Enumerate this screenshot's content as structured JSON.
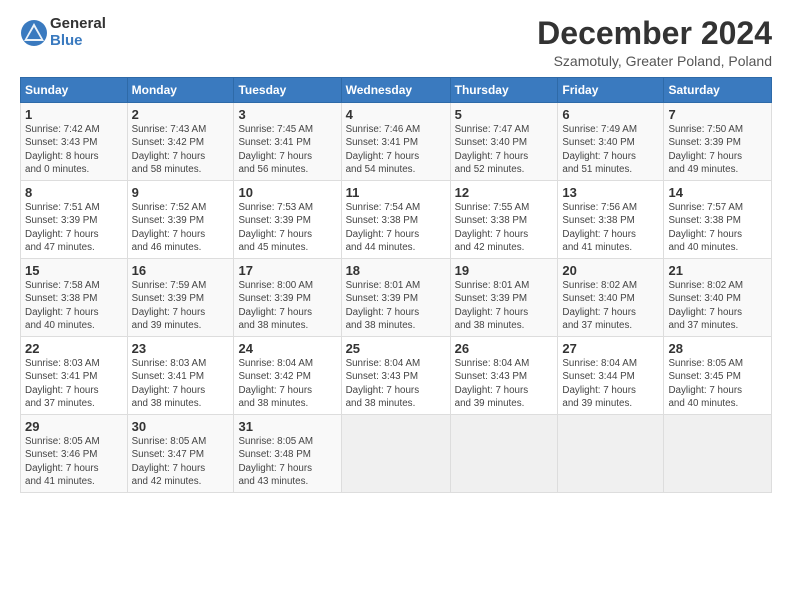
{
  "logo": {
    "general": "General",
    "blue": "Blue"
  },
  "title": "December 2024",
  "subtitle": "Szamotuly, Greater Poland, Poland",
  "days_header": [
    "Sunday",
    "Monday",
    "Tuesday",
    "Wednesday",
    "Thursday",
    "Friday",
    "Saturday"
  ],
  "weeks": [
    [
      {
        "day": "1",
        "sunrise": "7:42 AM",
        "sunset": "3:43 PM",
        "daylight": "8 hours and 0 minutes."
      },
      {
        "day": "2",
        "sunrise": "7:43 AM",
        "sunset": "3:42 PM",
        "daylight": "7 hours and 58 minutes."
      },
      {
        "day": "3",
        "sunrise": "7:45 AM",
        "sunset": "3:41 PM",
        "daylight": "7 hours and 56 minutes."
      },
      {
        "day": "4",
        "sunrise": "7:46 AM",
        "sunset": "3:41 PM",
        "daylight": "7 hours and 54 minutes."
      },
      {
        "day": "5",
        "sunrise": "7:47 AM",
        "sunset": "3:40 PM",
        "daylight": "7 hours and 52 minutes."
      },
      {
        "day": "6",
        "sunrise": "7:49 AM",
        "sunset": "3:40 PM",
        "daylight": "7 hours and 51 minutes."
      },
      {
        "day": "7",
        "sunrise": "7:50 AM",
        "sunset": "3:39 PM",
        "daylight": "7 hours and 49 minutes."
      }
    ],
    [
      {
        "day": "8",
        "sunrise": "7:51 AM",
        "sunset": "3:39 PM",
        "daylight": "7 hours and 47 minutes."
      },
      {
        "day": "9",
        "sunrise": "7:52 AM",
        "sunset": "3:39 PM",
        "daylight": "7 hours and 46 minutes."
      },
      {
        "day": "10",
        "sunrise": "7:53 AM",
        "sunset": "3:39 PM",
        "daylight": "7 hours and 45 minutes."
      },
      {
        "day": "11",
        "sunrise": "7:54 AM",
        "sunset": "3:38 PM",
        "daylight": "7 hours and 44 minutes."
      },
      {
        "day": "12",
        "sunrise": "7:55 AM",
        "sunset": "3:38 PM",
        "daylight": "7 hours and 42 minutes."
      },
      {
        "day": "13",
        "sunrise": "7:56 AM",
        "sunset": "3:38 PM",
        "daylight": "7 hours and 41 minutes."
      },
      {
        "day": "14",
        "sunrise": "7:57 AM",
        "sunset": "3:38 PM",
        "daylight": "7 hours and 40 minutes."
      }
    ],
    [
      {
        "day": "15",
        "sunrise": "7:58 AM",
        "sunset": "3:38 PM",
        "daylight": "7 hours and 40 minutes."
      },
      {
        "day": "16",
        "sunrise": "7:59 AM",
        "sunset": "3:39 PM",
        "daylight": "7 hours and 39 minutes."
      },
      {
        "day": "17",
        "sunrise": "8:00 AM",
        "sunset": "3:39 PM",
        "daylight": "7 hours and 38 minutes."
      },
      {
        "day": "18",
        "sunrise": "8:01 AM",
        "sunset": "3:39 PM",
        "daylight": "7 hours and 38 minutes."
      },
      {
        "day": "19",
        "sunrise": "8:01 AM",
        "sunset": "3:39 PM",
        "daylight": "7 hours and 38 minutes."
      },
      {
        "day": "20",
        "sunrise": "8:02 AM",
        "sunset": "3:40 PM",
        "daylight": "7 hours and 37 minutes."
      },
      {
        "day": "21",
        "sunrise": "8:02 AM",
        "sunset": "3:40 PM",
        "daylight": "7 hours and 37 minutes."
      }
    ],
    [
      {
        "day": "22",
        "sunrise": "8:03 AM",
        "sunset": "3:41 PM",
        "daylight": "7 hours and 37 minutes."
      },
      {
        "day": "23",
        "sunrise": "8:03 AM",
        "sunset": "3:41 PM",
        "daylight": "7 hours and 38 minutes."
      },
      {
        "day": "24",
        "sunrise": "8:04 AM",
        "sunset": "3:42 PM",
        "daylight": "7 hours and 38 minutes."
      },
      {
        "day": "25",
        "sunrise": "8:04 AM",
        "sunset": "3:43 PM",
        "daylight": "7 hours and 38 minutes."
      },
      {
        "day": "26",
        "sunrise": "8:04 AM",
        "sunset": "3:43 PM",
        "daylight": "7 hours and 39 minutes."
      },
      {
        "day": "27",
        "sunrise": "8:04 AM",
        "sunset": "3:44 PM",
        "daylight": "7 hours and 39 minutes."
      },
      {
        "day": "28",
        "sunrise": "8:05 AM",
        "sunset": "3:45 PM",
        "daylight": "7 hours and 40 minutes."
      }
    ],
    [
      {
        "day": "29",
        "sunrise": "8:05 AM",
        "sunset": "3:46 PM",
        "daylight": "7 hours and 41 minutes."
      },
      {
        "day": "30",
        "sunrise": "8:05 AM",
        "sunset": "3:47 PM",
        "daylight": "7 hours and 42 minutes."
      },
      {
        "day": "31",
        "sunrise": "8:05 AM",
        "sunset": "3:48 PM",
        "daylight": "7 hours and 43 minutes."
      },
      null,
      null,
      null,
      null
    ]
  ]
}
